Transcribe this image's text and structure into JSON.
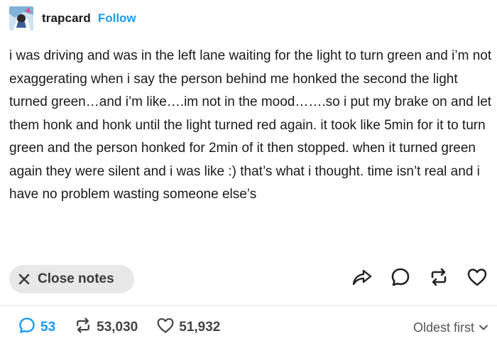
{
  "post": {
    "username": "trapcard",
    "follow_label": "Follow",
    "text": "i was driving and was in the left lane waiting for the light to turn green and i’m not exaggerating when i say the person behind me honked the second the light turned green…and i’m like….im not in the mood…….so i put my brake on and let them honk and honk until the light turned red again. it took like 5min for it to turn green and the person honked for 2min of it then stopped.   when it turned green again they were silent and i was like :) that’s what i thought. time isn’t real and i have no problem wasting someone else’s"
  },
  "notes_bar": {
    "close_label": "Close notes"
  },
  "actions": {
    "icons": [
      "share-icon",
      "reply-icon",
      "reblog-icon",
      "like-icon"
    ]
  },
  "stats": {
    "replies": "53",
    "reblogs": "53,030",
    "likes": "51,932"
  },
  "sort": {
    "label": "Oldest first"
  },
  "colors": {
    "accent": "#1d9bf0",
    "text": "#1a1a1a",
    "muted": "#444444",
    "pill_bg": "#e8e8e8"
  }
}
